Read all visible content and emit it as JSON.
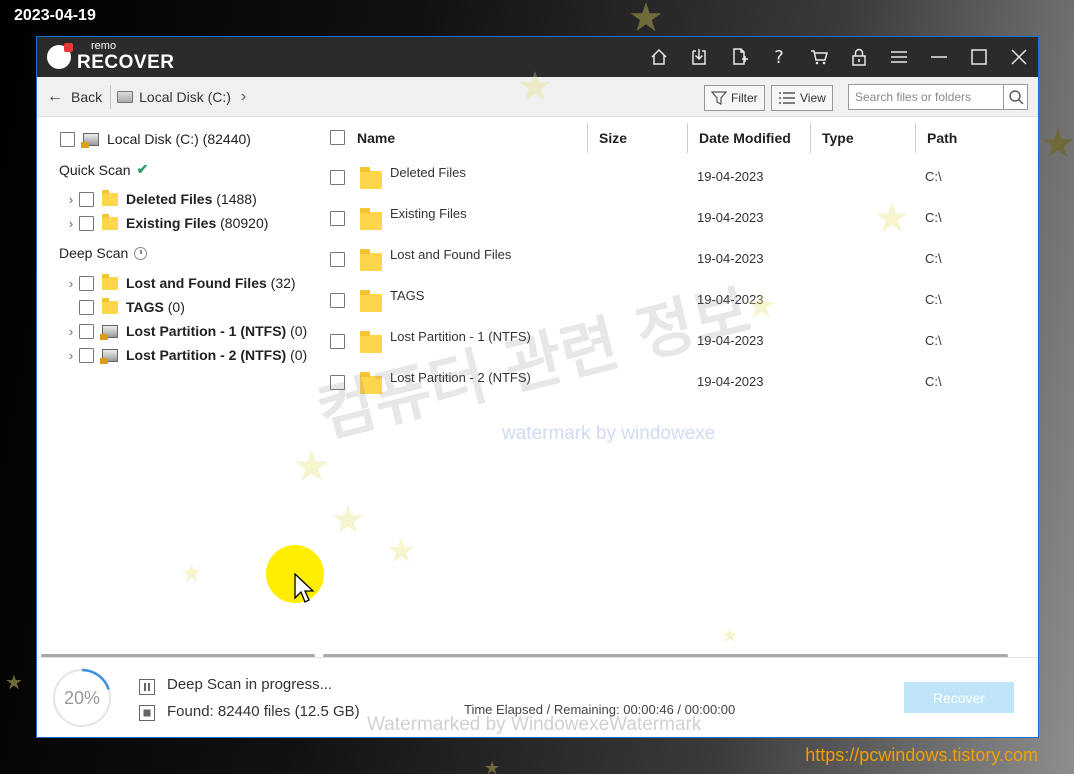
{
  "overlay": {
    "date": "2023-04-19",
    "url": "https://pcwindows.tistory.com"
  },
  "app": {
    "logo_small": "remo",
    "logo_big": "RECOVER",
    "titlebar_icons": [
      "home-icon",
      "download-icon",
      "file-add-icon",
      "help-icon",
      "cart-icon",
      "lock-icon",
      "menu-icon",
      "minimize-icon",
      "maximize-icon",
      "close-icon"
    ],
    "help_glyph": "?"
  },
  "nav": {
    "back_label": "Back",
    "crumb_label": "Local Disk (C:)",
    "filter_label": "Filter",
    "view_label": "View",
    "search_placeholder": "Search files or folders"
  },
  "tree": {
    "root": {
      "label": "Local Disk (C:) (82440)"
    },
    "quick_scan": {
      "label": "Quick Scan",
      "items": [
        {
          "name": "Deleted Files",
          "count": "(1488)"
        },
        {
          "name": "Existing Files",
          "count": "(80920)"
        }
      ]
    },
    "deep_scan": {
      "label": "Deep Scan",
      "items": [
        {
          "name": "Lost and Found Files",
          "count": "(32)"
        },
        {
          "name": "TAGS",
          "count": "(0)"
        },
        {
          "name": "Lost Partition - 1 (NTFS)",
          "count": "(0)"
        },
        {
          "name": "Lost Partition - 2 (NTFS)",
          "count": "(0)"
        }
      ]
    }
  },
  "table": {
    "columns": [
      "Name",
      "Size",
      "Date Modified",
      "Type",
      "Path"
    ],
    "rows": [
      {
        "name": "Deleted Files",
        "date": "19-04-2023",
        "path": "C:\\"
      },
      {
        "name": "Existing Files",
        "date": "19-04-2023",
        "path": "C:\\"
      },
      {
        "name": "Lost and Found Files",
        "date": "19-04-2023",
        "path": "C:\\"
      },
      {
        "name": "TAGS",
        "date": "19-04-2023",
        "path": "C:\\"
      },
      {
        "name": "Lost Partition - 1 (NTFS)",
        "date": "19-04-2023",
        "path": "C:\\"
      },
      {
        "name": "Lost Partition - 2 (NTFS)",
        "date": "19-04-2023",
        "path": "C:\\"
      }
    ]
  },
  "status": {
    "progress_percent": 20,
    "progress_label": "20%",
    "scan_status": "Deep Scan in progress...",
    "found_label": "Found:",
    "found_value": "82440 files (12.5 GB)",
    "time_label": "Time Elapsed / Remaining:",
    "time_value": "00:00:46 / 00:00:00",
    "recover_label": "Recover"
  },
  "watermarks": {
    "korean": "컴퓨터 관련 정보",
    "windowexe": "watermark by windowexe",
    "bottom": "Watermarked by WindowexeWatermark"
  },
  "colors": {
    "titlebar": "#2b2b2b",
    "accent_check": "#2e9e6b",
    "recover_button": "#bfe3f7",
    "folder": "#ffd54a",
    "progress_arc": "#3a8fe0",
    "url": "#f0a000"
  }
}
